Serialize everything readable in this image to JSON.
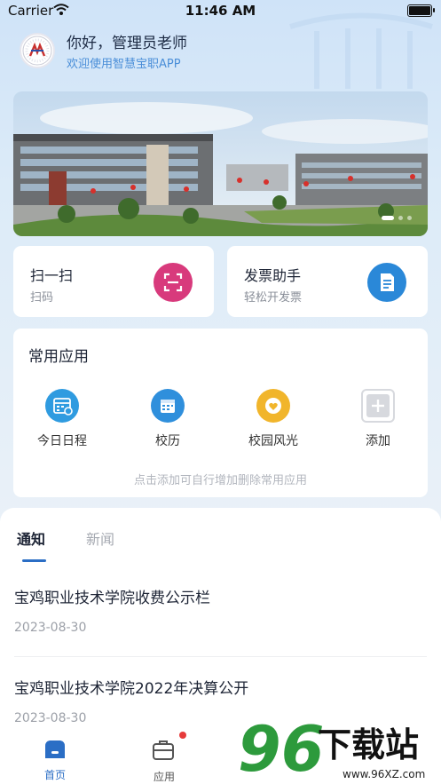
{
  "status_bar": {
    "carrier": "Carrier",
    "time": "11:46 AM"
  },
  "header": {
    "greeting": "你好，管理员老师",
    "welcome": "欢迎使用智慧宝职APP"
  },
  "banner": {
    "page_index": 1,
    "page_count": 3
  },
  "quick_actions": [
    {
      "title": "扫一扫",
      "subtitle": "扫码",
      "icon": "scan-icon",
      "color": "#d83a7c"
    },
    {
      "title": "发票助手",
      "subtitle": "轻松开发票",
      "icon": "invoice-icon",
      "color": "#2a88d8"
    }
  ],
  "common_apps": {
    "title": "常用应用",
    "items": [
      {
        "label": "今日日程",
        "icon": "schedule-icon",
        "color": "#2f9be0"
      },
      {
        "label": "校历",
        "icon": "calendar-icon",
        "color": "#2f8fdc"
      },
      {
        "label": "校园风光",
        "icon": "heart-icon",
        "color": "#f1b52b"
      },
      {
        "label": "添加",
        "icon": "add-icon",
        "color": "#d7d9de"
      }
    ],
    "hint": "点击添加可自行增加删除常用应用"
  },
  "news": {
    "tabs": [
      {
        "label": "通知",
        "active": true
      },
      {
        "label": "新闻",
        "active": false
      }
    ],
    "items": [
      {
        "title": "宝鸡职业技术学院收费公示栏",
        "date": "2023-08-30"
      },
      {
        "title": "宝鸡职业技术学院2022年决算公开",
        "date": "2023-08-30"
      }
    ]
  },
  "bottom_nav": [
    {
      "label": "首页",
      "icon": "home-icon",
      "active": true
    },
    {
      "label": "应用",
      "icon": "apps-icon",
      "active": false,
      "badge": true
    }
  ],
  "watermark": {
    "brand": "96下载站",
    "url": "www.96XZ.com"
  },
  "colors": {
    "accent": "#2b6ec5",
    "badge": "#e63b3b"
  }
}
